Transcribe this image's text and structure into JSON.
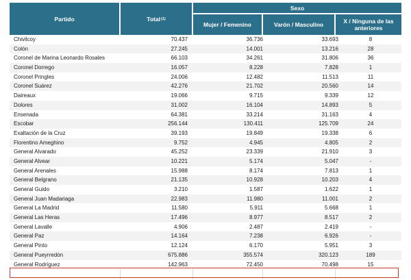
{
  "headers": {
    "partido": "Partido",
    "total": "Total",
    "total_note": "(1)",
    "sexo": "Sexo",
    "fem": "Mujer / Femenino",
    "masc": "Varón / Masculino",
    "x": "X / Ninguna de las anteriores"
  },
  "rows": [
    {
      "name": "Chivilcoy",
      "total": "70.437",
      "fem": "36.736",
      "masc": "33.693",
      "x": "8"
    },
    {
      "name": "Colón",
      "total": "27.245",
      "fem": "14.001",
      "masc": "13.216",
      "x": "28"
    },
    {
      "name": "Coronel de Marina Leonardo Rosales",
      "total": "66.103",
      "fem": "34.261",
      "masc": "31.806",
      "x": "36"
    },
    {
      "name": "Coronel Dorrego",
      "total": "16.057",
      "fem": "8.228",
      "masc": "7.828",
      "x": "1"
    },
    {
      "name": "Coronel Pringles",
      "total": "24.006",
      "fem": "12.482",
      "masc": "11.513",
      "x": "11"
    },
    {
      "name": "Coronel Suárez",
      "total": "42.276",
      "fem": "21.702",
      "masc": "20.560",
      "x": "14"
    },
    {
      "name": "Daireaux",
      "total": "19.066",
      "fem": "9.715",
      "masc": "9.339",
      "x": "12"
    },
    {
      "name": "Dolores",
      "total": "31.002",
      "fem": "16.104",
      "masc": "14.893",
      "x": "5"
    },
    {
      "name": "Ensenada",
      "total": "64.381",
      "fem": "33.214",
      "masc": "31.163",
      "x": "4"
    },
    {
      "name": "Escobar",
      "total": "256.144",
      "fem": "130.411",
      "masc": "125.709",
      "x": "24"
    },
    {
      "name": "Exaltación de la Cruz",
      "total": "39.193",
      "fem": "19.849",
      "masc": "19.338",
      "x": "6"
    },
    {
      "name": "Florentino Ameghino",
      "total": "9.752",
      "fem": "4.945",
      "masc": "4.805",
      "x": "2"
    },
    {
      "name": "General Alvarado",
      "total": "45.252",
      "fem": "23.339",
      "masc": "21.910",
      "x": "3"
    },
    {
      "name": "General Alvear",
      "total": "10.221",
      "fem": "5.174",
      "masc": "5.047",
      "x": "-"
    },
    {
      "name": "General Arenales",
      "total": "15.988",
      "fem": "8.174",
      "masc": "7.813",
      "x": "1"
    },
    {
      "name": "General Belgrano",
      "total": "21.135",
      "fem": "10.928",
      "masc": "10.203",
      "x": "4"
    },
    {
      "name": "General Guido",
      "total": "3.210",
      "fem": "1.587",
      "masc": "1.622",
      "x": "1"
    },
    {
      "name": "General Juan Madariaga",
      "total": "22.983",
      "fem": "11.980",
      "masc": "11.001",
      "x": "2"
    },
    {
      "name": "General La Madrid",
      "total": "11.580",
      "fem": "5.911",
      "masc": "5.668",
      "x": "1"
    },
    {
      "name": "General Las Heras",
      "total": "17.496",
      "fem": "8.977",
      "masc": "8.517",
      "x": "2"
    },
    {
      "name": "General Lavalle",
      "total": "4.906",
      "fem": "2.487",
      "masc": "2.419",
      "x": "-"
    },
    {
      "name": "General Paz",
      "total": "14.164",
      "fem": "7.238",
      "masc": "6.926",
      "x": "-"
    },
    {
      "name": "General Pinto",
      "total": "12.124",
      "fem": "6.170",
      "masc": "5.951",
      "x": "3"
    },
    {
      "name": "General Pueyrredón",
      "total": "675.886",
      "fem": "355.574",
      "masc": "320.123",
      "x": "189"
    },
    {
      "name": "General Rodríguez",
      "total": "142.963",
      "fem": "72.450",
      "masc": "70.498",
      "x": "15"
    }
  ]
}
